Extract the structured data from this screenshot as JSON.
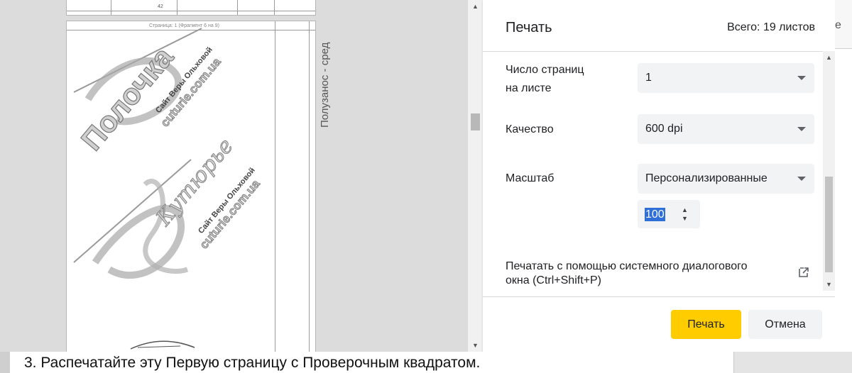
{
  "preview": {
    "page_header_text": "Страница: 1  (Фрагмент 6 на 9)",
    "top_page_number": "42",
    "side_text": "Полузанос - сред",
    "watermark_title": "Полочка",
    "watermark_site_name": "Сайт Веры Ольховой",
    "watermark_url": "cuturie.com.ua",
    "watermark_script": "Кутюрье"
  },
  "print_dialog": {
    "title": "Печать",
    "sheet_count": "Всего: 19 листов",
    "pages_per_sheet": {
      "label_line1": "Число страниц",
      "label_line2": "на листе",
      "value": "1"
    },
    "quality": {
      "label": "Качество",
      "value": "600 dpi"
    },
    "scale": {
      "label": "Масштаб",
      "value": "Персонализированные",
      "custom_value": "100"
    },
    "system_dialog": {
      "label": "Печатать с помощью системного диалогового окна (Ctrl+Shift+P)"
    },
    "buttons": {
      "print": "Печать",
      "cancel": "Отмена"
    }
  },
  "right_edge": {
    "text": "е"
  },
  "instruction": "3. Распечатайте эту Первую страницу с Проверочным квадратом.",
  "colors": {
    "print_button": "#ffcc00",
    "select_bg": "#f1f3f4",
    "selection": "#2f6fd8"
  },
  "icons": [
    "open-external-icon",
    "chevron-down-icon",
    "spin-up-icon",
    "spin-down-icon"
  ]
}
